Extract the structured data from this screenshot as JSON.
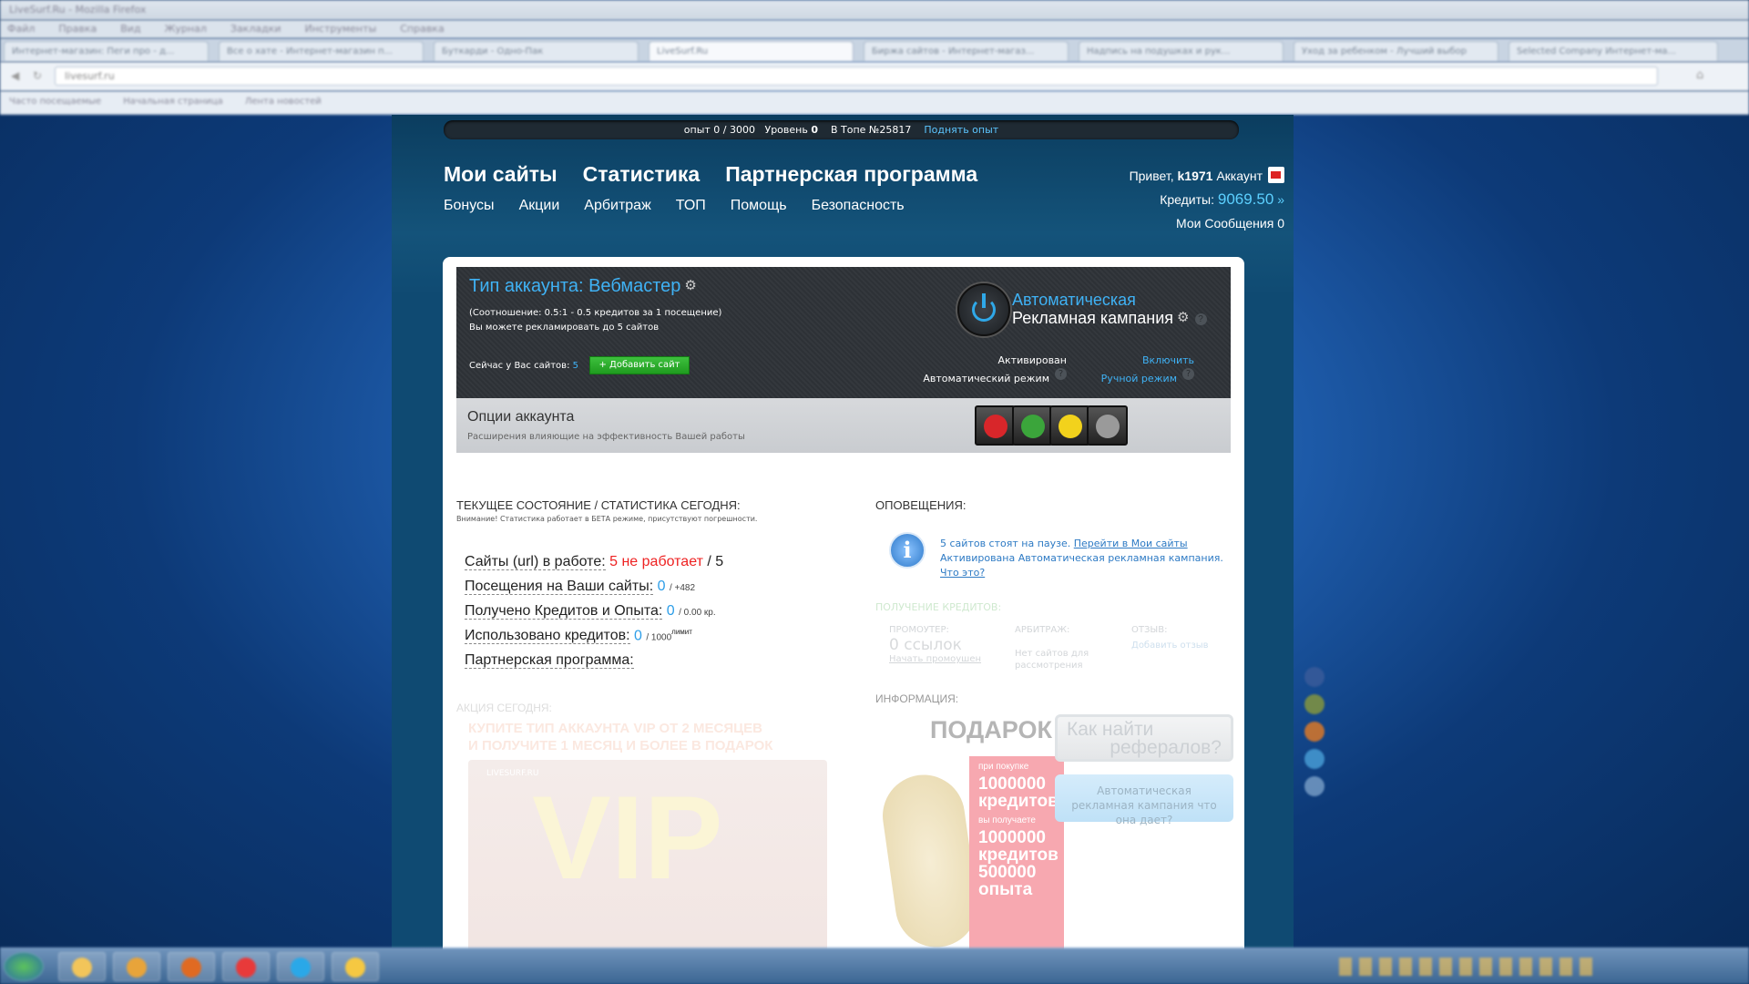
{
  "browser": {
    "title": "LiveSurf.Ru - Mozilla Firefox",
    "menu": [
      "Файл",
      "Правка",
      "Вид",
      "Журнал",
      "Закладки",
      "Инструменты",
      "Справка"
    ],
    "tabs": [
      "Интернет-магазин: Пеги про - д...",
      "Все о хате - Интернет-магазин п...",
      "Буткарди - Одно-Пак",
      "LiveSurf.Ru",
      "Биржа сайтов - Интернет-магаз...",
      "Надпись на подушках и рук...",
      "Уход за ребенком - Лучший выбор",
      "Selected Company Интернет-ма..."
    ],
    "url": "livesurf.ru",
    "bookmarks": [
      "Часто посещаемые",
      "Начальная страница",
      "Лента новостей"
    ]
  },
  "header": {
    "exp": "опыт 0 / 3000",
    "level_label": "Уровень",
    "level_value": "0",
    "top_label": "В Топе №25817",
    "raise_link": "Поднять опыт",
    "main_nav": [
      "Мои сайты",
      "Статистика",
      "Партнерская программа"
    ],
    "sub_nav": [
      "Бонусы",
      "Акции",
      "Арбитраж",
      "ТОП",
      "Помощь",
      "Безопасность"
    ],
    "greeting": "Привет,",
    "username": "k1971",
    "account_link": "Аккаунт",
    "credits_label": "Кредиты:",
    "credits_value": "9069.50",
    "messages_label": "Мои Сообщения",
    "messages_count": "0"
  },
  "account": {
    "type_label": "Тип аккаунта: Вебмастер",
    "ratio": "(Соотношение: 0.5:1 - 0.5 кредитов за 1 посещение)",
    "limit": "Вы можете рекламировать до 5 сайтов",
    "current_sites_label": "Сейчас у Вас сайтов:",
    "current_sites_count": "5",
    "add_site_button": "+ Добавить сайт",
    "auto_title_1": "Автоматическая",
    "auto_title_2": "Рекламная кампания",
    "activated_1": "Активирован",
    "activated_2": "Автоматический режим",
    "enable_1": "Включить",
    "enable_2": "Ручной режим",
    "options_title": "Опции аккаунта",
    "options_desc": "Расширения влияющие на эффективность Вашей работы"
  },
  "stats": {
    "title": "ТЕКУЩЕЕ СОСТОЯНИЕ / СТАТИСТИКА СЕГОДНЯ:",
    "warning": "Внимание! Статистика работает в БЕТА режиме, присутствуют погрешности.",
    "sites_label": "Сайты (url) в работе:",
    "sites_not_working": "5 не работает",
    "sites_total": "/ 5",
    "visits_label": "Посещения на Ваши сайты:",
    "visits_value": "0",
    "visits_extra": "/ +482",
    "earned_label": "Получено Кредитов и Опыта:",
    "earned_value": "0",
    "earned_extra": "/ 0.00 кр.",
    "used_label": "Использовано кредитов:",
    "used_value": "0",
    "used_extra": "/ 1000",
    "used_sup": "лимит",
    "partner_label": "Партнерская программа:",
    "action_title": "АКЦИЯ СЕГОДНЯ:",
    "action_line1": "КУПИТЕ ТИП АККАУНТА VIP ОТ 2 МЕСЯЦЕВ",
    "action_line2": "И ПОЛУЧИТЕ 1 МЕСЯЦ И БОЛЕЕ В ПОДАРОК",
    "vip_brand": "LIVESURF.RU",
    "vip_text": "VIP"
  },
  "notifications": {
    "title": "ОПОВЕЩЕНИЯ:",
    "line1_count": "5",
    "line1_text": "сайтов стоят на паузе.",
    "line1_link": "Перейти в Мои сайты",
    "line2_text": "Активирована Автоматическая рекламная кампания.",
    "line2_link": "Что это?"
  },
  "credits_gain": {
    "title": "ПОЛУЧЕНИЕ КРЕДИТОВ:",
    "promo_label": "ПРОМОУТЕР:",
    "promo_value": "0 ссылок",
    "promo_link": "Начать промоушен",
    "arb_label": "АРБИТРАЖ:",
    "arb_text_1": "Нет сайтов для",
    "arb_text_2": "рассмотрения",
    "review_label": "ОТЗЫВ:",
    "review_link": "Добавить отзыв"
  },
  "info": {
    "title": "ИНФОРМАЦИЯ:",
    "gift_title": "ПОДАРОК",
    "gift_s1": "при покупке",
    "gift_b1": "1000000",
    "gift_b2": "кредитов",
    "gift_s2": "вы получаете",
    "gift_b3": "1000000",
    "gift_b4": "кредитов",
    "gift_b5": "500000",
    "gift_b6": "опыта",
    "ref_button_1": "Как найти",
    "ref_button_2": "рефералов?",
    "auto_button": "Автоматическая рекламная кампания что она дает?"
  },
  "colors": {
    "accent_blue": "#3fb2f5",
    "alert_red": "#ee2222",
    "green_button": "#2aae2a"
  }
}
